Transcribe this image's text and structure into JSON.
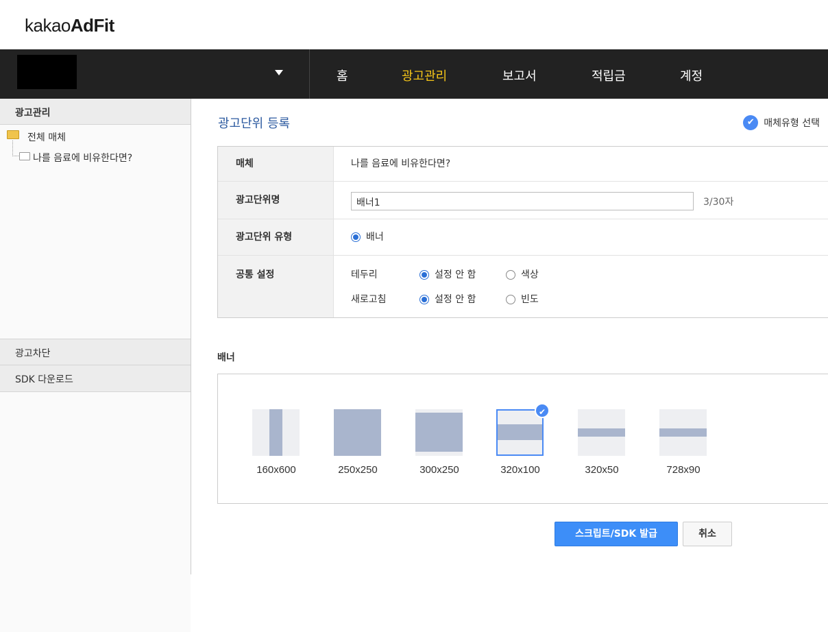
{
  "logo": {
    "light": "kakao",
    "bold": "AdFit"
  },
  "nav": {
    "items": [
      {
        "label": "홈"
      },
      {
        "label": "광고관리",
        "active": true
      },
      {
        "label": "보고서"
      },
      {
        "label": "적립금"
      },
      {
        "label": "계정"
      }
    ]
  },
  "sidebar": {
    "header": "광고관리",
    "tree": {
      "root": "전체 매체",
      "child": "나를 음료에 비유한다면?"
    },
    "sections": [
      "광고차단",
      "SDK 다운로드"
    ]
  },
  "main": {
    "title": "광고단위 등록",
    "media_type_select": "매체유형 선택",
    "form": {
      "media_label": "매체",
      "media_value": "나를 음료에 비유한다면?",
      "unit_name_label": "광고단위명",
      "unit_name_value": "배너1",
      "unit_name_count": "3/30자",
      "unit_type_label": "광고단위 유형",
      "unit_type_option": "배너",
      "common_label": "공통 설정",
      "border_label": "테두리",
      "border_options": [
        "설정 안 함",
        "색상"
      ],
      "refresh_label": "새로고침",
      "refresh_options": [
        "설정 안 함",
        "빈도"
      ]
    },
    "banner_section_title": "배너",
    "banners": [
      {
        "size": "160x600"
      },
      {
        "size": "250x250"
      },
      {
        "size": "300x250"
      },
      {
        "size": "320x100",
        "selected": true
      },
      {
        "size": "320x50"
      },
      {
        "size": "728x90"
      }
    ],
    "issue_button": "스크립트/SDK 발급",
    "cancel_button": "취소"
  },
  "colors": {
    "nav_bg": "#222222",
    "nav_active": "#f5c518",
    "accent": "#3d8ef8",
    "title": "#2c5aa0"
  }
}
